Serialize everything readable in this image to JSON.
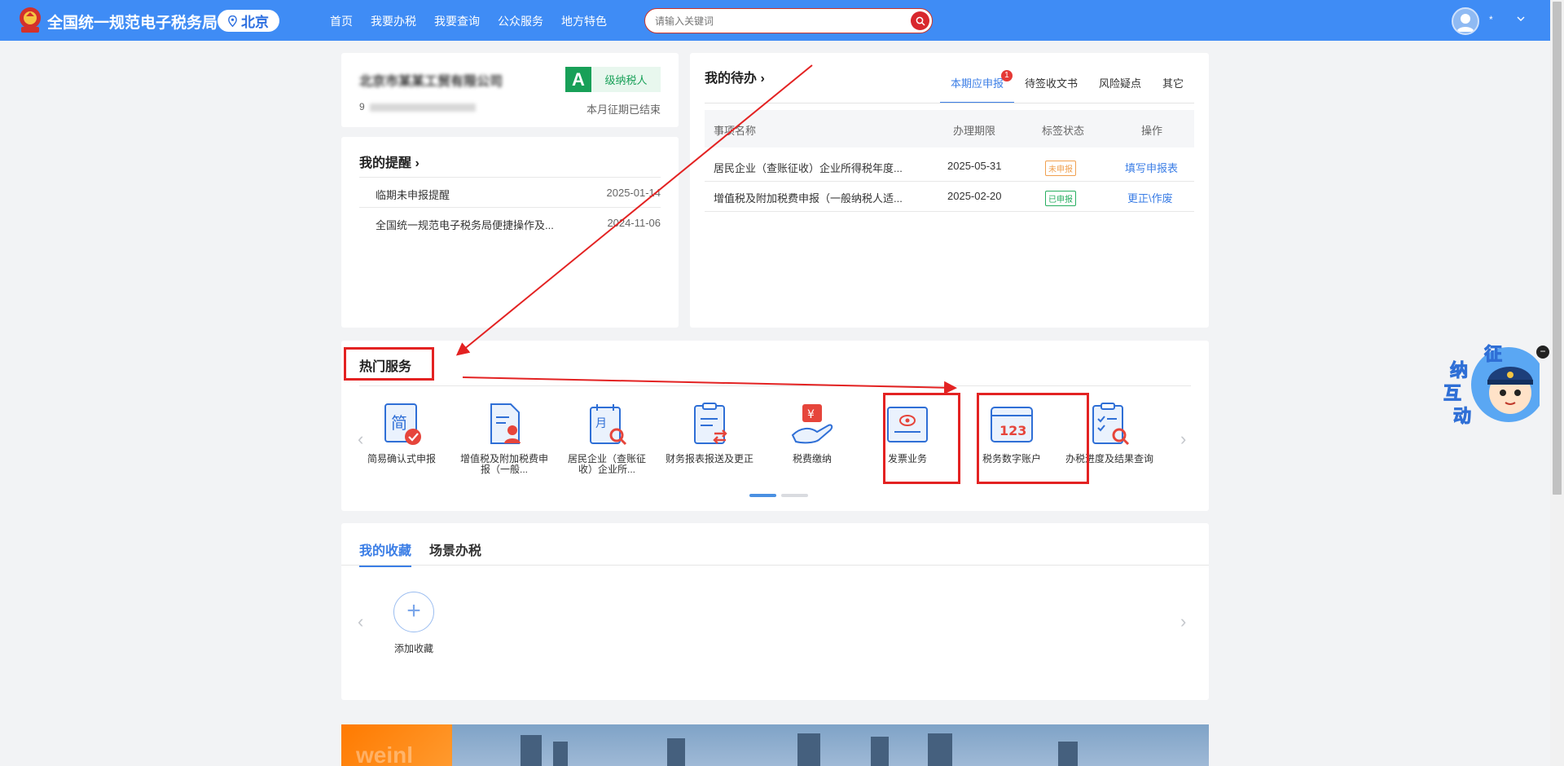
{
  "header": {
    "brand": "全国统一规范电子税务局",
    "city": "北京",
    "nav": [
      "首页",
      "我要办税",
      "我要查询",
      "公众服务",
      "地方特色"
    ],
    "search_placeholder": "请输入关键词",
    "username": "*",
    "brand_color": "#3f8cf5"
  },
  "company": {
    "name": "北京市某某工贸有限公司",
    "tax_id_prefix": "9",
    "grade": "A",
    "grade_label": "级纳税人",
    "period_status": "本月征期已结束"
  },
  "reminders": {
    "title": "我的提醒",
    "items": [
      {
        "text": "临期未申报提醒",
        "date": "2025-01-14"
      },
      {
        "text": "全国统一规范电子税务局便捷操作及...",
        "date": "2024-11-06"
      }
    ]
  },
  "todo": {
    "title": "我的待办",
    "tabs": [
      {
        "label": "本期应申报",
        "badge": "1"
      },
      {
        "label": "待签收文书"
      },
      {
        "label": "风险疑点"
      },
      {
        "label": "其它"
      }
    ],
    "columns": [
      "事项名称",
      "办理期限",
      "标签状态",
      "操作"
    ],
    "rows": [
      {
        "name": "居民企业（查账征收）企业所得税年度...",
        "deadline": "2025-05-31",
        "status": "未申报",
        "status_color": "#f0a050",
        "action": "填写申报表"
      },
      {
        "name": "增值税及附加税费申报（一般纳税人适...",
        "deadline": "2025-02-20",
        "status": "已申报",
        "status_color": "#27ae60",
        "action": "更正\\作废"
      }
    ]
  },
  "hot_services": {
    "title": "热门服务",
    "items": [
      {
        "label": "简易确认式申报",
        "icon": "simple-declare-icon"
      },
      {
        "label": "增值税及附加税费申报（一般...",
        "icon": "vat-declare-icon"
      },
      {
        "label": "居民企业（查账征收）企业所...",
        "icon": "corp-income-icon"
      },
      {
        "label": "财务报表报送及更正",
        "icon": "financial-report-icon"
      },
      {
        "label": "税费缴纳",
        "icon": "tax-payment-icon"
      },
      {
        "label": "发票业务",
        "icon": "invoice-icon"
      },
      {
        "label": "税务数字账户",
        "icon": "digital-account-icon"
      },
      {
        "label": "办税进度及结果查询",
        "icon": "progress-query-icon"
      }
    ]
  },
  "favorites": {
    "tabs": [
      "我的收藏",
      "场景办税"
    ],
    "add_label": "添加收藏"
  },
  "banner": {
    "text": "weinl"
  },
  "assistant": {
    "chars": [
      "征",
      "纳",
      "互",
      "动"
    ]
  }
}
